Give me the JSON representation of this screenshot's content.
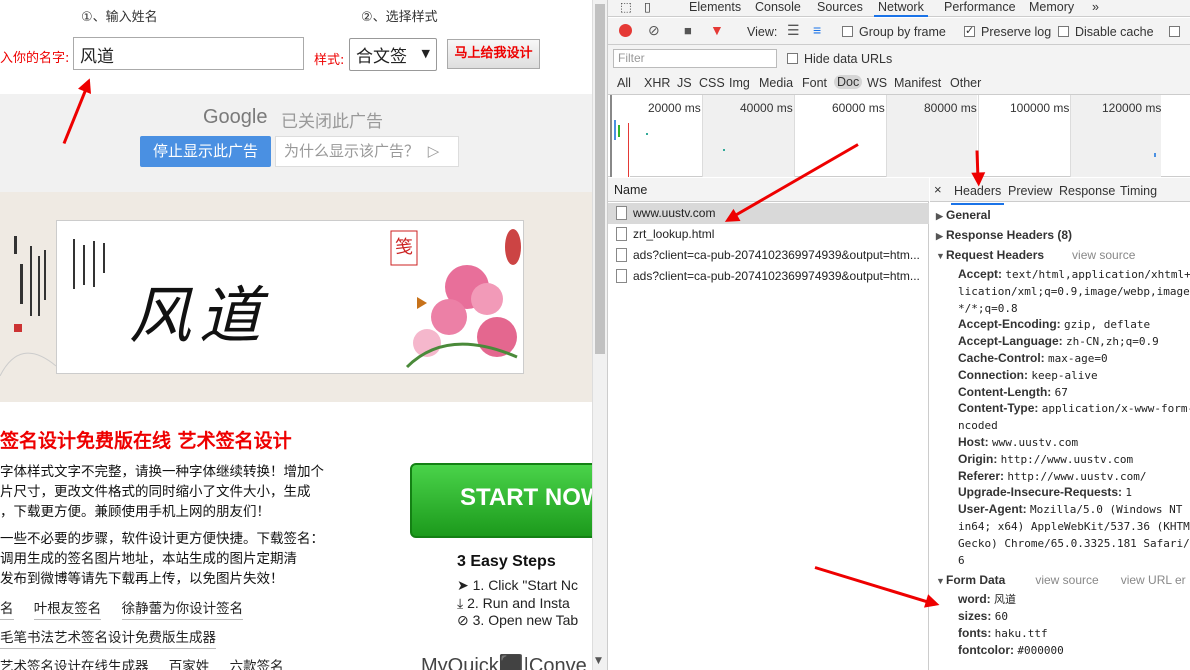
{
  "site": {
    "step1": "①、输入姓名",
    "step2": "②、选择样式",
    "name_label": "入你的名字:",
    "name_value": "风道",
    "style_label": "样式:",
    "style_value": "合文签",
    "go_button": "马上给我设计",
    "ad": {
      "google": "Google",
      "closed": "已关闭此广告",
      "stop": "停止显示此广告",
      "why": "为什么显示该广告？"
    },
    "signature": "风道",
    "heading": "签名设计免费版在线 艺术签名设计",
    "paragraph1": [
      "字体样式文字不完整，请换一种字体继续转换！增加个",
      "片尺寸，更改文件格式的同时缩小了文件大小，生成",
      "，下载更方便。兼顾使用手机上网的朋友们！"
    ],
    "paragraph2": [
      "一些不必要的步骤，软件设计更方便快捷。下载签名：",
      "调用生成的签名图片地址，本站生成的图片定期清",
      "发布到微博等请先下载再上传，以免图片失效！"
    ],
    "links1": [
      "名",
      "叶根友签名",
      "徐静蕾为你设计签名"
    ],
    "links2": [
      "毛笔书法艺术签名设计免费版生成器"
    ],
    "links3": [
      "艺术签名设计在线生成器",
      "百家姓",
      "六款签名"
    ],
    "start_now": "START NOW",
    "steps_title": "3 Easy Steps",
    "steps": [
      "1. Click \"Start Nc",
      "2. Run and Insta",
      "3. Open new Tab"
    ],
    "myquick": "MyQuick⬛|Conve"
  },
  "devtools": {
    "tabs": [
      "Elements",
      "Console",
      "Sources",
      "Network",
      "Performance",
      "Memory",
      "»"
    ],
    "active_tab": "Network",
    "toolbar": {
      "view_label": "View:",
      "group_by_frame": "Group by frame",
      "preserve_log": "Preserve log",
      "disable_cache": "Disable cache"
    },
    "filter_placeholder": "Filter",
    "hide_data_urls": "Hide data URLs",
    "types": [
      "All",
      "XHR",
      "JS",
      "CSS",
      "Img",
      "Media",
      "Font",
      "Doc",
      "WS",
      "Manifest",
      "Other"
    ],
    "selected_type": "Doc",
    "timeline_labels": [
      "20000 ms",
      "40000 ms",
      "60000 ms",
      "80000 ms",
      "100000 ms",
      "120000 ms"
    ],
    "name_header": "Name",
    "requests": [
      "www.uustv.com",
      "zrt_lookup.html",
      "ads?client=ca-pub-2074102369974939&output=htm...",
      "ads?client=ca-pub-2074102369974939&output=htm..."
    ],
    "detail_tabs": [
      "Headers",
      "Preview",
      "Response",
      "Timing"
    ],
    "close": "×",
    "general": "General",
    "response_headers": "Response Headers (8)",
    "request_headers": "Request Headers",
    "view_source": "view source",
    "view_url_encoded": "view URL er",
    "request_header_rows": [
      {
        "k": "Accept:",
        "v": "text/html,application/xhtml+"
      },
      {
        "k": "",
        "v": "lication/xml;q=0.9,image/webp,image/"
      },
      {
        "k": "",
        "v": "*/*;q=0.8"
      },
      {
        "k": "Accept-Encoding:",
        "v": "gzip, deflate"
      },
      {
        "k": "Accept-Language:",
        "v": "zh-CN,zh;q=0.9"
      },
      {
        "k": "Cache-Control:",
        "v": "max-age=0"
      },
      {
        "k": "Connection:",
        "v": "keep-alive"
      },
      {
        "k": "Content-Length:",
        "v": "67"
      },
      {
        "k": "Content-Type:",
        "v": "application/x-www-form-"
      },
      {
        "k": "",
        "v": "ncoded"
      },
      {
        "k": "Host:",
        "v": "www.uustv.com"
      },
      {
        "k": "Origin:",
        "v": "http://www.uustv.com"
      },
      {
        "k": "Referer:",
        "v": "http://www.uustv.com/"
      },
      {
        "k": "Upgrade-Insecure-Requests:",
        "v": "1"
      },
      {
        "k": "User-Agent:",
        "v": "Mozilla/5.0 (Windows NT"
      },
      {
        "k": "",
        "v": "in64; x64) AppleWebKit/537.36 (KHTM"
      },
      {
        "k": "",
        "v": "Gecko) Chrome/65.0.3325.181 Safari/5"
      },
      {
        "k": "",
        "v": "6"
      }
    ],
    "form_data": "Form Data",
    "form_rows": [
      {
        "k": "word:",
        "v": "风道"
      },
      {
        "k": "sizes:",
        "v": "60"
      },
      {
        "k": "fonts:",
        "v": "haku.ttf"
      },
      {
        "k": "fontcolor:",
        "v": "#000000"
      }
    ]
  },
  "colors": {
    "annotation": "#e00000",
    "accent": "#1a73e8",
    "start_green": "#2db52d"
  }
}
